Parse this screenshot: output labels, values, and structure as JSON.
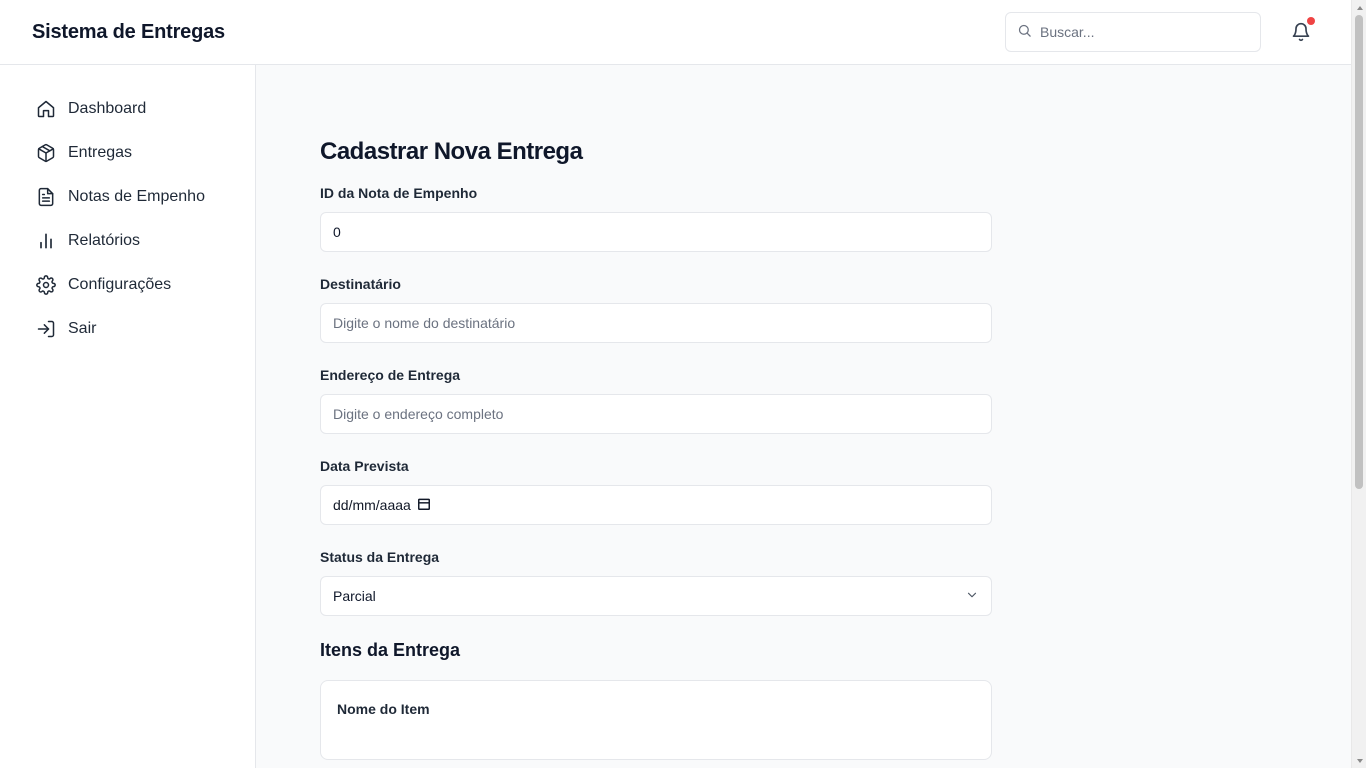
{
  "header": {
    "app_title": "Sistema de Entregas",
    "search_placeholder": "Buscar...",
    "search_icon": "search-icon",
    "notification_icon": "bell-icon",
    "notification_dot_color": "#ef4444"
  },
  "sidebar": {
    "items": [
      {
        "label": "Dashboard",
        "icon": "home-icon"
      },
      {
        "label": "Entregas",
        "icon": "package-icon"
      },
      {
        "label": "Notas de Empenho",
        "icon": "file-text-icon"
      },
      {
        "label": "Relatórios",
        "icon": "bar-chart-icon"
      },
      {
        "label": "Configurações",
        "icon": "gear-icon"
      },
      {
        "label": "Sair",
        "icon": "log-in-icon"
      }
    ]
  },
  "form": {
    "title": "Cadastrar Nova Entrega",
    "fields": {
      "nota_empenho": {
        "label": "ID da Nota de Empenho",
        "value": "0"
      },
      "destinatario": {
        "label": "Destinatário",
        "value": "",
        "placeholder": "Digite o nome do destinatário"
      },
      "endereco": {
        "label": "Endereço de Entrega",
        "value": "",
        "placeholder": "Digite o endereço completo"
      },
      "data_prevista": {
        "label": "Data Prevista",
        "value": "dd/mm/aaaa"
      },
      "status": {
        "label": "Status da Entrega",
        "value": "Parcial"
      }
    },
    "items_section": {
      "title": "Itens da Entrega",
      "item_name_label": "Nome do Item"
    }
  }
}
